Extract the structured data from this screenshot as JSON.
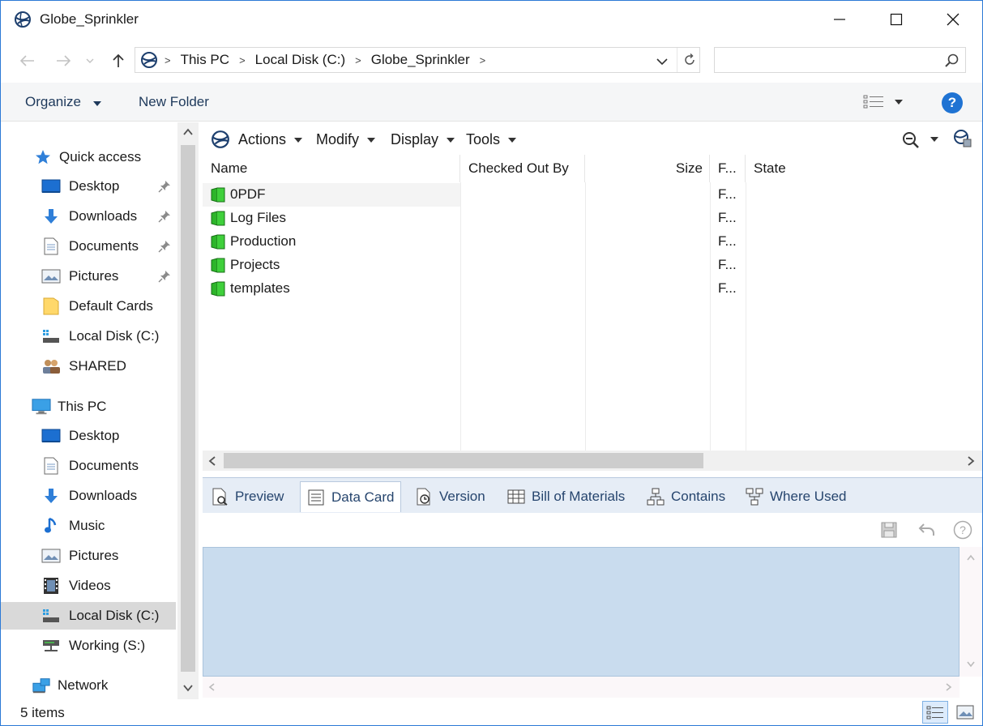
{
  "window": {
    "title": "Globe_Sprinkler",
    "minimize_label": "—",
    "maximize_label": "☐",
    "close_label": "✕"
  },
  "address": {
    "breadcrumbs": [
      "This PC",
      "Local Disk (C:)",
      "Globe_Sprinkler"
    ],
    "search_placeholder": ""
  },
  "commandbar": {
    "organize_label": "Organize",
    "new_folder_label": "New Folder",
    "help_label": "?"
  },
  "navpane": {
    "quick_access": {
      "label": "Quick access",
      "items": [
        {
          "label": "Desktop",
          "pinned": true
        },
        {
          "label": "Downloads",
          "pinned": true
        },
        {
          "label": "Documents",
          "pinned": true
        },
        {
          "label": "Pictures",
          "pinned": true
        },
        {
          "label": "Default Cards",
          "pinned": false
        },
        {
          "label": "Local Disk (C:)",
          "pinned": false
        },
        {
          "label": "SHARED",
          "pinned": false
        }
      ]
    },
    "this_pc": {
      "label": "This PC",
      "items": [
        {
          "label": "Desktop"
        },
        {
          "label": "Documents"
        },
        {
          "label": "Downloads"
        },
        {
          "label": "Music"
        },
        {
          "label": "Pictures"
        },
        {
          "label": "Videos"
        },
        {
          "label": "Local Disk (C:)",
          "selected": true
        },
        {
          "label": "Working (S:)"
        }
      ]
    },
    "network": {
      "label": "Network"
    }
  },
  "vault_toolbar": {
    "actions_label": "Actions",
    "modify_label": "Modify",
    "display_label": "Display",
    "tools_label": "Tools"
  },
  "filelist": {
    "columns": {
      "name": "Name",
      "checked_out_by": "Checked Out By",
      "size": "Size",
      "f": "F...",
      "state": "State"
    },
    "rows": [
      {
        "name": "0PDF",
        "f": "F..."
      },
      {
        "name": "Log Files",
        "f": "F..."
      },
      {
        "name": "Production",
        "f": "F..."
      },
      {
        "name": "Projects",
        "f": "F..."
      },
      {
        "name": "templates",
        "f": "F..."
      }
    ]
  },
  "tabs": {
    "preview": "Preview",
    "data_card": "Data Card",
    "version": "Version",
    "bom": "Bill of Materials",
    "contains": "Contains",
    "where_used": "Where Used"
  },
  "status": {
    "item_count": "5 items"
  },
  "colors": {
    "accent": "#1f73d3",
    "folder_green": "#2db52a",
    "datacard_panel": "#c9dcee",
    "tab_bar": "#e6edf6",
    "selection": "#d9d9d9"
  }
}
